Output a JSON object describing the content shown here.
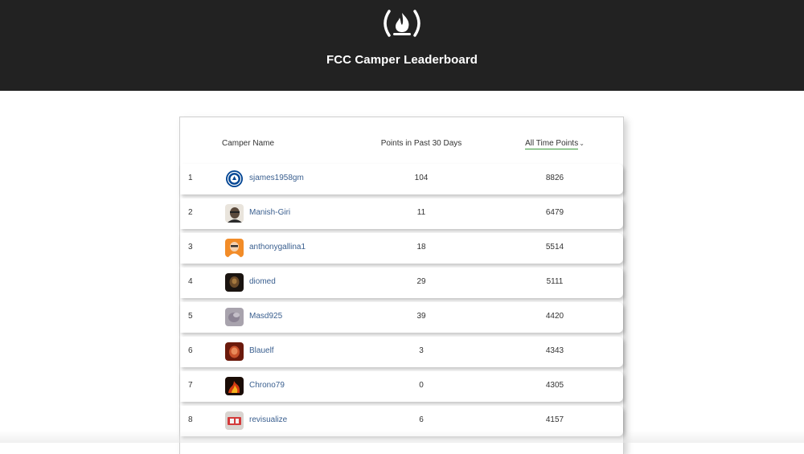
{
  "header": {
    "title": "FCC Camper Leaderboard",
    "logo_icon": "freecodecamp-flame-icon",
    "background": "#222222"
  },
  "table": {
    "columns": {
      "rank": "",
      "name": "Camper Name",
      "recent": "Points in Past 30 Days",
      "alltime": "All Time Points",
      "sort_indicator": "chevron-down-icon"
    },
    "link_color": "#3a5f8f",
    "sort_underline_color": "#3c9a3c",
    "rows": [
      {
        "rank": "1",
        "username": "sjames1958gm",
        "recent": "104",
        "alltime": "8826",
        "avatar": "chelsea-crest-icon"
      },
      {
        "rank": "2",
        "username": "Manish-Giri",
        "recent": "11",
        "alltime": "6479",
        "avatar": "photo-avatar"
      },
      {
        "rank": "3",
        "username": "anthonygallina1",
        "recent": "18",
        "alltime": "5514",
        "avatar": "cartoon-avatar"
      },
      {
        "rank": "4",
        "username": "diomed",
        "recent": "29",
        "alltime": "5111",
        "avatar": "photo-avatar"
      },
      {
        "rank": "5",
        "username": "Masd925",
        "recent": "39",
        "alltime": "4420",
        "avatar": "photo-avatar"
      },
      {
        "rank": "6",
        "username": "Blauelf",
        "recent": "3",
        "alltime": "4343",
        "avatar": "photo-avatar"
      },
      {
        "rank": "7",
        "username": "Chrono79",
        "recent": "0",
        "alltime": "4305",
        "avatar": "fire-avatar"
      },
      {
        "rank": "8",
        "username": "revisualize",
        "recent": "6",
        "alltime": "4157",
        "avatar": "photo-avatar"
      }
    ]
  }
}
